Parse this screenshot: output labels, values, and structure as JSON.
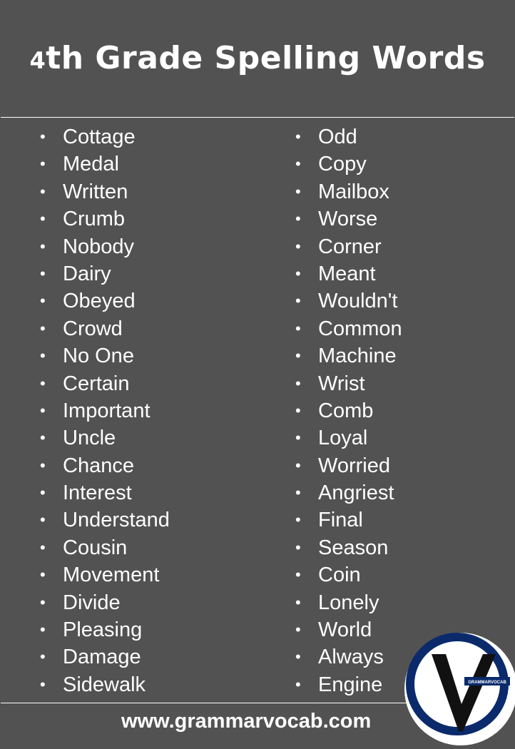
{
  "title": {
    "prefix": "4",
    "rest": "th Grade Spelling Words"
  },
  "words_left": [
    "Cottage",
    "Medal",
    "Written",
    "Crumb",
    "Nobody",
    "Dairy",
    "Obeyed",
    "Crowd",
    "No One",
    "Certain",
    "Important",
    "Uncle",
    "Chance",
    "Interest",
    "Understand",
    "Cousin",
    "Movement",
    "Divide",
    "Pleasing",
    "Damage",
    "Sidewalk"
  ],
  "words_right": [
    "Odd",
    "Copy",
    "Mailbox",
    "Worse",
    "Corner",
    "Meant",
    "Wouldn't",
    "Common",
    "Machine",
    "Wrist",
    "Comb",
    "Loyal",
    "Worried",
    "Angriest",
    "Final",
    "Season",
    "Coin",
    "Lonely",
    "World",
    "Always",
    "Engine"
  ],
  "bullet": "•",
  "footer": {
    "url": "www.grammarvocab.com"
  },
  "logo": {
    "text": "GRAMMARVOCAB",
    "colors": {
      "ring": "#0a2a6b",
      "v": "#111111"
    }
  }
}
